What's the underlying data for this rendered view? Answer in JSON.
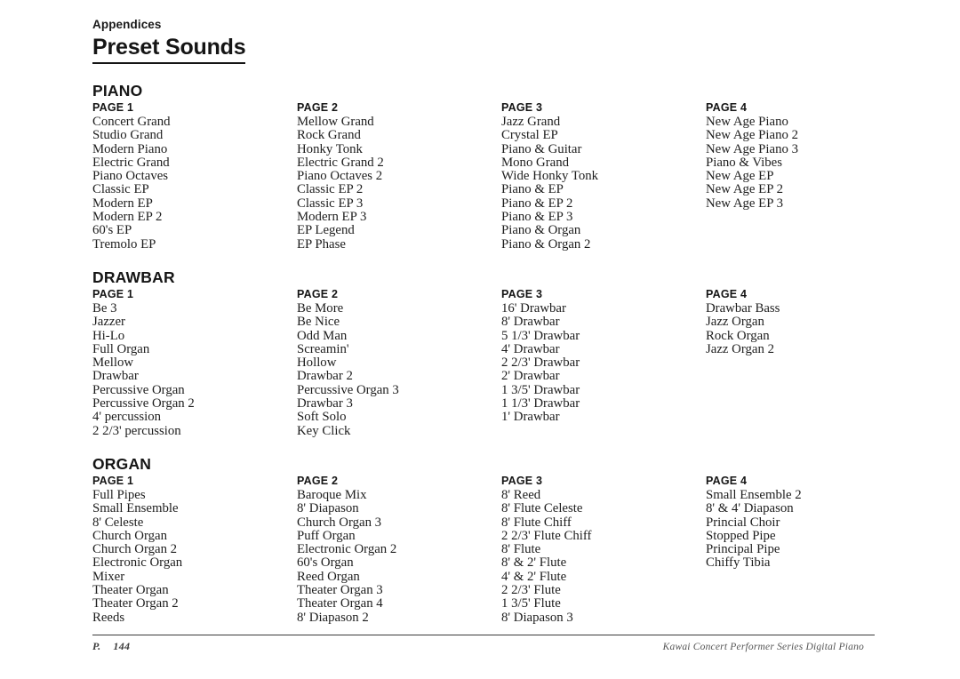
{
  "header": {
    "breadcrumb": "Appendices",
    "title": "Preset Sounds"
  },
  "sections": [
    {
      "name": "PIANO",
      "columns": [
        {
          "head": "PAGE 1",
          "items": [
            "Concert Grand",
            "Studio Grand",
            "Modern Piano",
            "Electric Grand",
            "Piano Octaves",
            "Classic EP",
            "Modern EP",
            "Modern EP 2",
            "60's EP",
            "Tremolo EP"
          ]
        },
        {
          "head": "PAGE 2",
          "items": [
            "Mellow Grand",
            "Rock Grand",
            "Honky Tonk",
            "Electric Grand 2",
            "Piano Octaves 2",
            "Classic EP 2",
            "Classic EP 3",
            "Modern EP 3",
            "EP Legend",
            "EP Phase"
          ]
        },
        {
          "head": "PAGE 3",
          "items": [
            "Jazz Grand",
            "Crystal EP",
            "Piano & Guitar",
            "Mono Grand",
            "Wide Honky Tonk",
            "Piano & EP",
            "Piano & EP 2",
            "Piano & EP 3",
            "Piano & Organ",
            "Piano & Organ 2"
          ]
        },
        {
          "head": "PAGE 4",
          "items": [
            "New Age Piano",
            "New Age Piano 2",
            "New Age Piano 3",
            "Piano & Vibes",
            "New Age EP",
            "New Age EP 2",
            "New Age EP 3"
          ]
        }
      ]
    },
    {
      "name": "DRAWBAR",
      "columns": [
        {
          "head": "PAGE 1",
          "items": [
            "Be 3",
            "Jazzer",
            "Hi-Lo",
            "Full Organ",
            "Mellow",
            "Drawbar",
            "Percussive Organ",
            "Percussive Organ 2",
            "4' percussion",
            "2 2/3' percussion"
          ]
        },
        {
          "head": "PAGE 2",
          "items": [
            "Be More",
            "Be Nice",
            "Odd Man",
            "Screamin'",
            "Hollow",
            "Drawbar 2",
            "Percussive Organ 3",
            "Drawbar 3",
            "Soft Solo",
            "Key Click"
          ]
        },
        {
          "head": "PAGE 3",
          "items": [
            "16' Drawbar",
            "8' Drawbar",
            "5 1/3' Drawbar",
            "4' Drawbar",
            "2 2/3' Drawbar",
            "2' Drawbar",
            "1 3/5' Drawbar",
            "1 1/3' Drawbar",
            "1' Drawbar"
          ]
        },
        {
          "head": "PAGE 4",
          "items": [
            "Drawbar Bass",
            "Jazz Organ",
            "Rock Organ",
            "Jazz Organ 2"
          ]
        }
      ]
    },
    {
      "name": "ORGAN",
      "columns": [
        {
          "head": "PAGE 1",
          "items": [
            "Full Pipes",
            "Small Ensemble",
            "8' Celeste",
            "Church Organ",
            "Church Organ 2",
            "Electronic Organ",
            "Mixer",
            "Theater Organ",
            "Theater Organ 2",
            "Reeds"
          ]
        },
        {
          "head": "PAGE 2",
          "items": [
            "Baroque Mix",
            "8' Diapason",
            "Church Organ 3",
            "Puff Organ",
            "Electronic Organ 2",
            "60's Organ",
            "Reed Organ",
            "Theater Organ 3",
            "Theater Organ 4",
            "8' Diapason 2"
          ]
        },
        {
          "head": "PAGE 3",
          "items": [
            "8' Reed",
            "8' Flute Celeste",
            "8' Flute Chiff",
            "2 2/3' Flute Chiff",
            "8' Flute",
            "8' & 2' Flute",
            "4' & 2' Flute",
            "2 2/3' Flute",
            "1 3/5' Flute",
            "8' Diapason 3"
          ]
        },
        {
          "head": "PAGE 4",
          "items": [
            "Small Ensemble 2",
            "8' & 4' Diapason",
            "Princial Choir",
            "Stopped Pipe",
            "Principal Pipe",
            "Chiffy Tibia"
          ]
        }
      ]
    }
  ],
  "footer": {
    "page_label": "P.",
    "page_number": "144",
    "product_line": "Kawai Concert Performer Series Digital Piano"
  }
}
